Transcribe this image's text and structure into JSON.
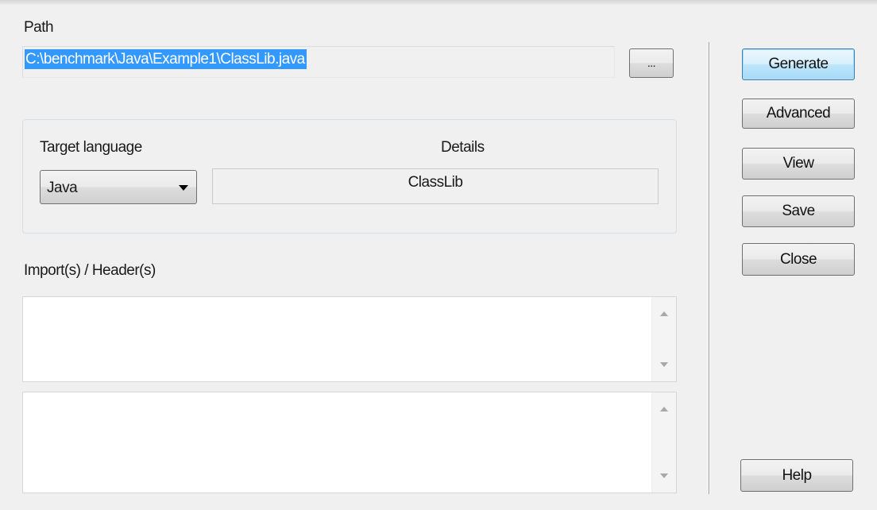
{
  "path": {
    "label": "Path",
    "value": "C:\\benchmark\\Java\\Example1\\ClassLib.java",
    "browse_label": "..."
  },
  "target": {
    "language_label": "Target language",
    "details_label": "Details",
    "language_value": "Java",
    "details_value": "ClassLib"
  },
  "imports": {
    "label": "Import(s) / Header(s)"
  },
  "buttons": {
    "generate": "Generate",
    "advanced": "Advanced",
    "view": "View",
    "save": "Save",
    "close": "Close",
    "help": "Help"
  },
  "colors": {
    "selection": "#3399ff",
    "default_button_border": "#3c7fb1",
    "dialog_background": "#f0f0f0"
  }
}
